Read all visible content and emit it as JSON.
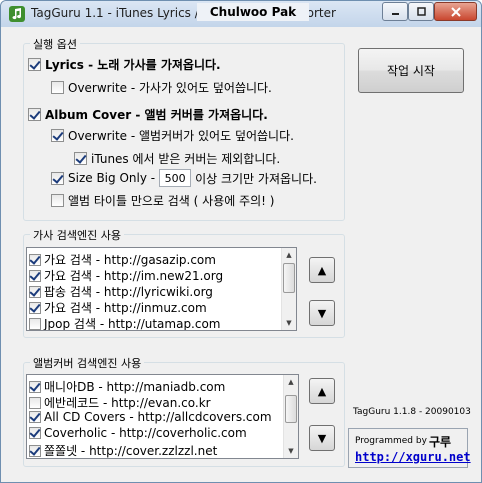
{
  "window": {
    "title": "TagGuru 1.1 - iTunes Lyrics / Album Cover Importer",
    "title_overlay": "Chulwoo Pak"
  },
  "options": {
    "group_title": "실행 옵션",
    "lyrics_label": "Lyrics - 노래 가사를 가져옵니다.",
    "lyrics_checked": true,
    "lyrics_overwrite_label": "Overwrite - 가사가 있어도 덮어씁니다.",
    "lyrics_overwrite_checked": false,
    "cover_label": "Album Cover - 앨범 커버를 가져옵니다.",
    "cover_checked": true,
    "cover_overwrite_label": "Overwrite - 앨범커버가 있어도 덮어씁니다.",
    "cover_overwrite_checked": true,
    "itunes_exclude_label": "iTunes 에서 받은 커버는 제외합니다.",
    "itunes_exclude_checked": true,
    "size_big_only_label": "Size Big Only -",
    "size_big_only_checked": true,
    "size_value": "500",
    "size_suffix": "이상 크기만 가져옵니다.",
    "album_title_only_label": "앨범 타이틀 만으로 검색 ( 사용에 주의! )",
    "album_title_only_checked": false
  },
  "start_button": "작업 시작",
  "lyrics_engines": {
    "group_title": "가사 검색엔진 사용",
    "items": [
      {
        "label": "가요 검색 - http://gasazip.com",
        "checked": true
      },
      {
        "label": "가요 검색 - http://im.new21.org",
        "checked": true
      },
      {
        "label": "팝송 검색 - http://lyricwiki.org",
        "checked": true
      },
      {
        "label": "가요 검색 - http://inmuz.com",
        "checked": true
      },
      {
        "label": "Jpop 검색 - http://utamap.com",
        "checked": false
      }
    ]
  },
  "cover_engines": {
    "group_title": "앨범커버 검색엔진 사용",
    "items": [
      {
        "label": "매니아DB - http://maniadb.com",
        "checked": true
      },
      {
        "label": "에반레코드 - http://evan.co.kr",
        "checked": false
      },
      {
        "label": "All CD Covers - http://allcdcovers.com",
        "checked": true
      },
      {
        "label": "Coverholic - http://coverholic.com",
        "checked": true
      },
      {
        "label": "쫄쫄넷 - http://cover.zzlzzl.net",
        "checked": true
      }
    ]
  },
  "footer": {
    "version": "TagGuru 1.1.8 - 20090103",
    "programmed_by": "Programmed by",
    "author": "구루",
    "link": "http://xguru.net"
  }
}
